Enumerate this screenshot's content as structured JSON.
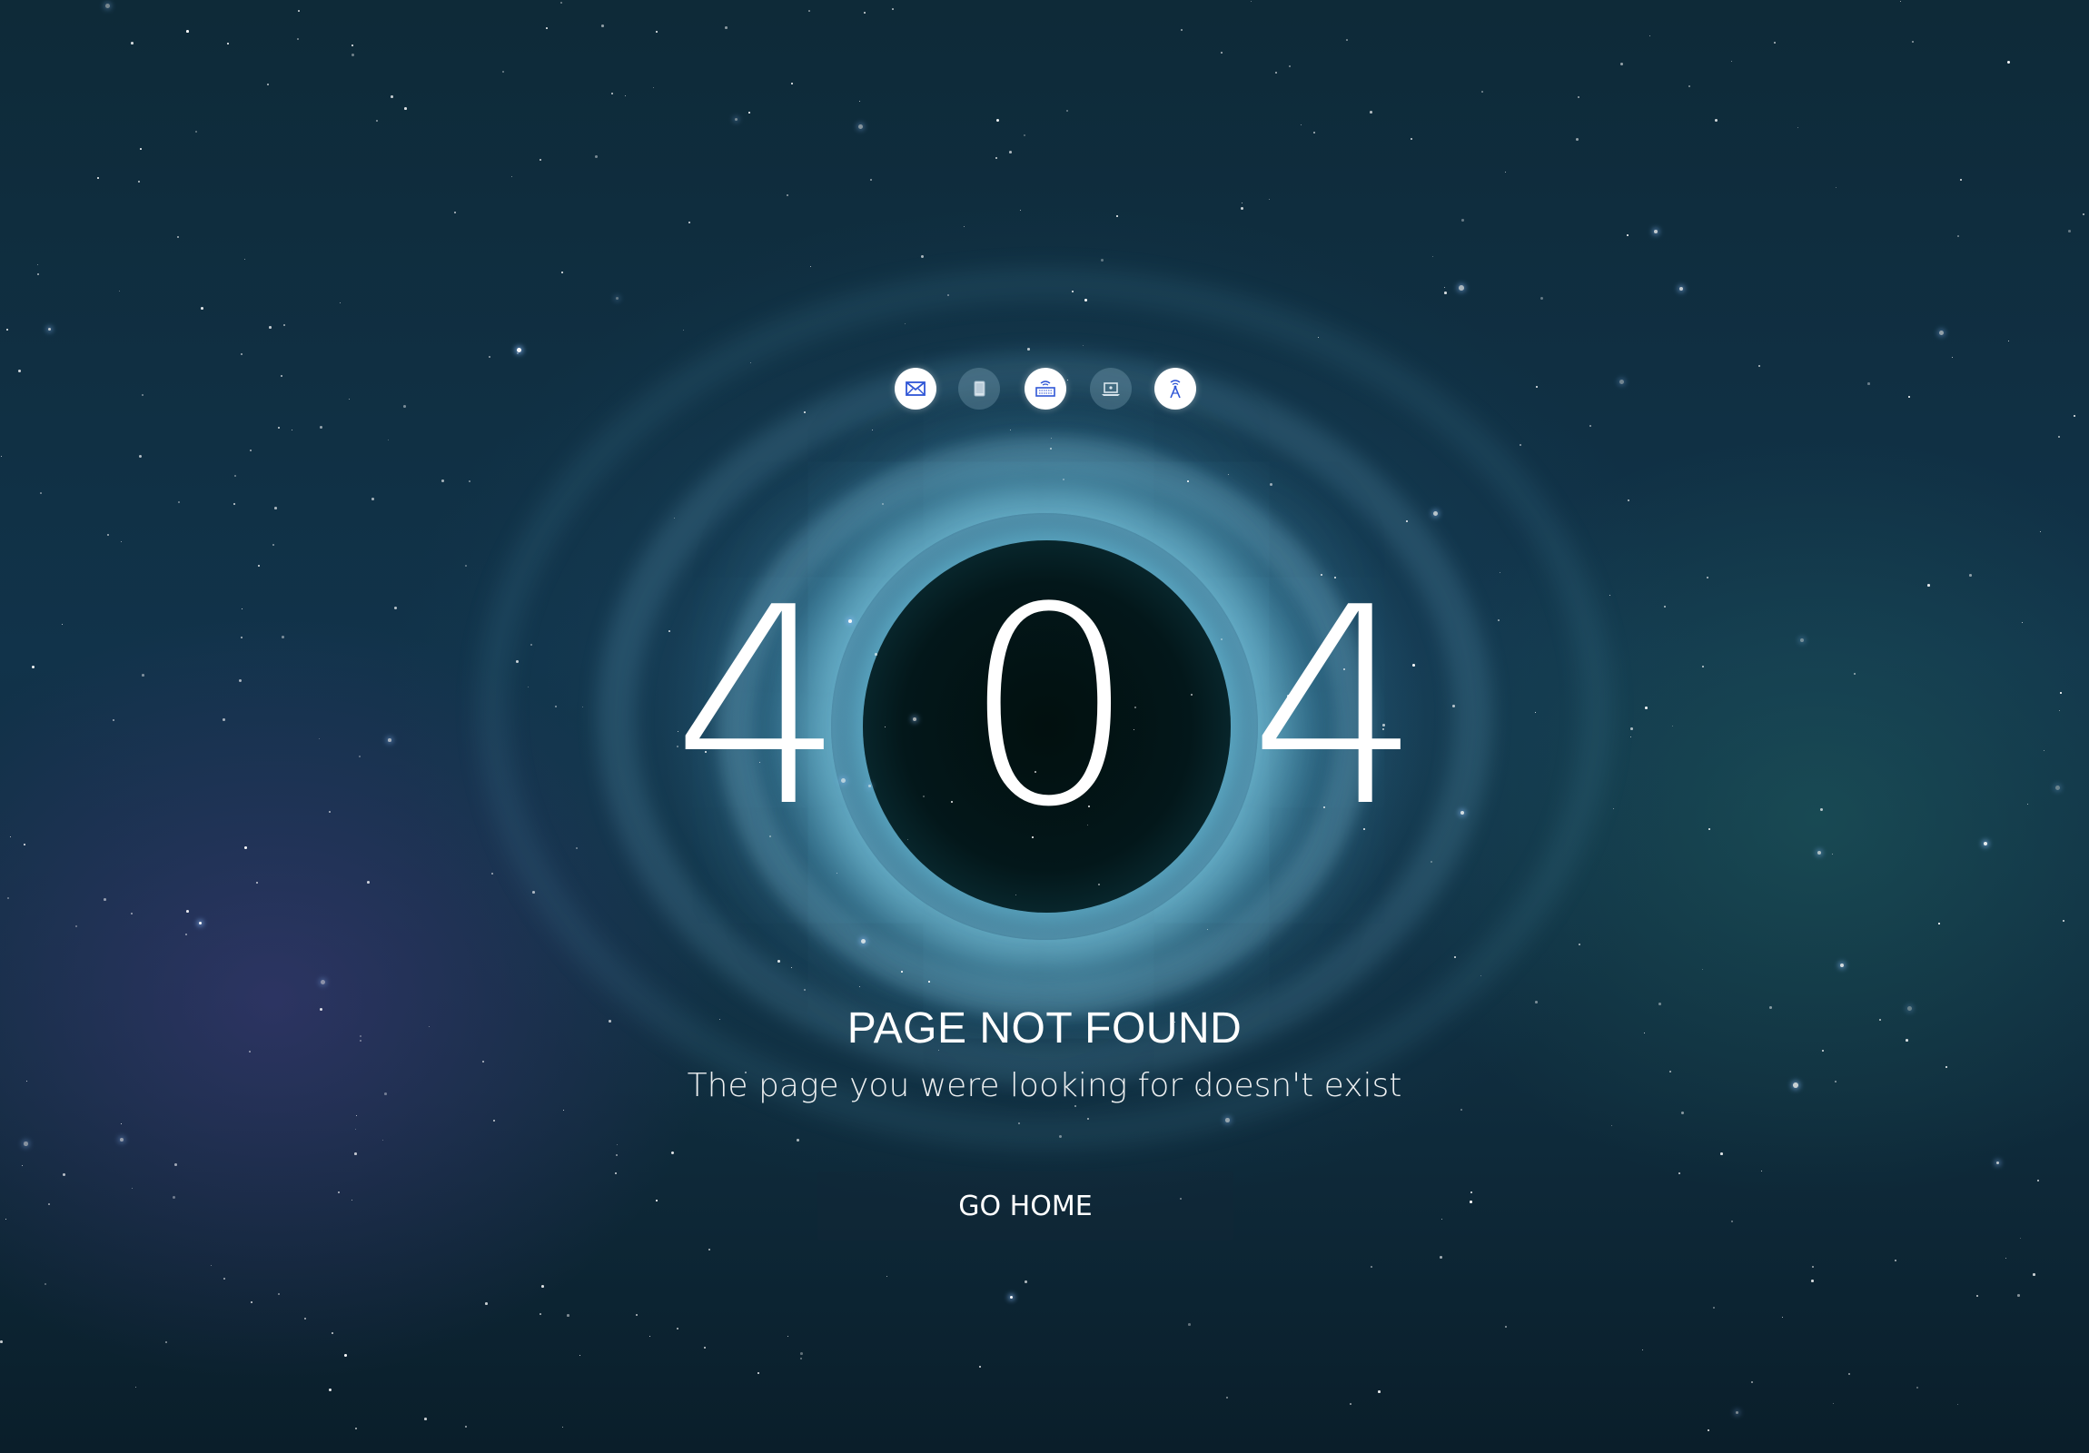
{
  "icons": [
    {
      "name": "mail",
      "state": "active"
    },
    {
      "name": "tablet",
      "state": "inactive"
    },
    {
      "name": "keyboard",
      "state": "active"
    },
    {
      "name": "laptop",
      "state": "inactive"
    },
    {
      "name": "antenna",
      "state": "active"
    }
  ],
  "error": {
    "digits": [
      "4",
      "0",
      "4"
    ]
  },
  "message": {
    "title": "PAGE NOT FOUND",
    "subtitle": "The page you were looking for doesn't exist"
  },
  "actions": {
    "home_label": "GO HOME"
  },
  "colors": {
    "accent": "#2f56d6",
    "text": "#ffffff",
    "background": "#11334a"
  }
}
